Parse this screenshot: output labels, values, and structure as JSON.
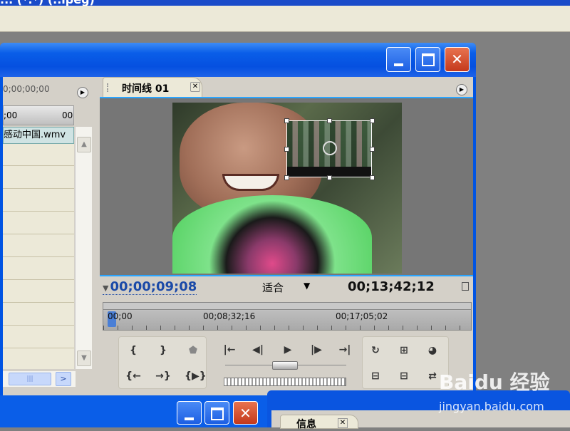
{
  "previous_window": {
    "title_fragment": "... (*.*) (..ipeg)"
  },
  "main_window": {
    "buttons": {
      "minimize": "minimize",
      "maximize": "maximize",
      "close": "✕"
    }
  },
  "left_panel": {
    "timecode": "0;00;00;00",
    "ruler_start": ";00",
    "ruler_end": "00",
    "clip_name": "感动中国.wmv",
    "scroll_thumb_glyph": "|||",
    "scroll_right": ">"
  },
  "timeline_panel": {
    "tab_label": "时间线 01",
    "tab_close": "✕",
    "menu_glyph": "▶",
    "current_timecode": "00;00;09;08",
    "fit_label": "适合",
    "fit_dropdown": "▼",
    "duration": "00;13;42;12",
    "ruler_labels": [
      "00;00",
      "00;08;32;16",
      "00;17;05;02"
    ],
    "progress_fraction": 0.011
  },
  "controls": {
    "set_in": "{",
    "set_out": "}",
    "set_marker": "⬟",
    "go_to_in": "|←",
    "step_back": "◀|",
    "play": "▶",
    "step_forward": "|▶",
    "go_to_out": "→|",
    "play_in_to_out": "{←",
    "loop": "→}",
    "safe_margins": "{▶}",
    "output": "↻",
    "lift": "⊞",
    "extract": "⊟",
    "trim": "⇄",
    "overlay": "◕"
  },
  "bottom_window": {
    "info_label": "信息",
    "info_close": "✕"
  },
  "watermark": {
    "main": "Baidu 经验",
    "sub": "jingyan.baidu.com"
  },
  "colors": {
    "xp_blue": "#0054e3",
    "accent_line": "#2aa5ff",
    "timecode_blue": "#1b4aa8",
    "close_red": "#c4391c"
  }
}
